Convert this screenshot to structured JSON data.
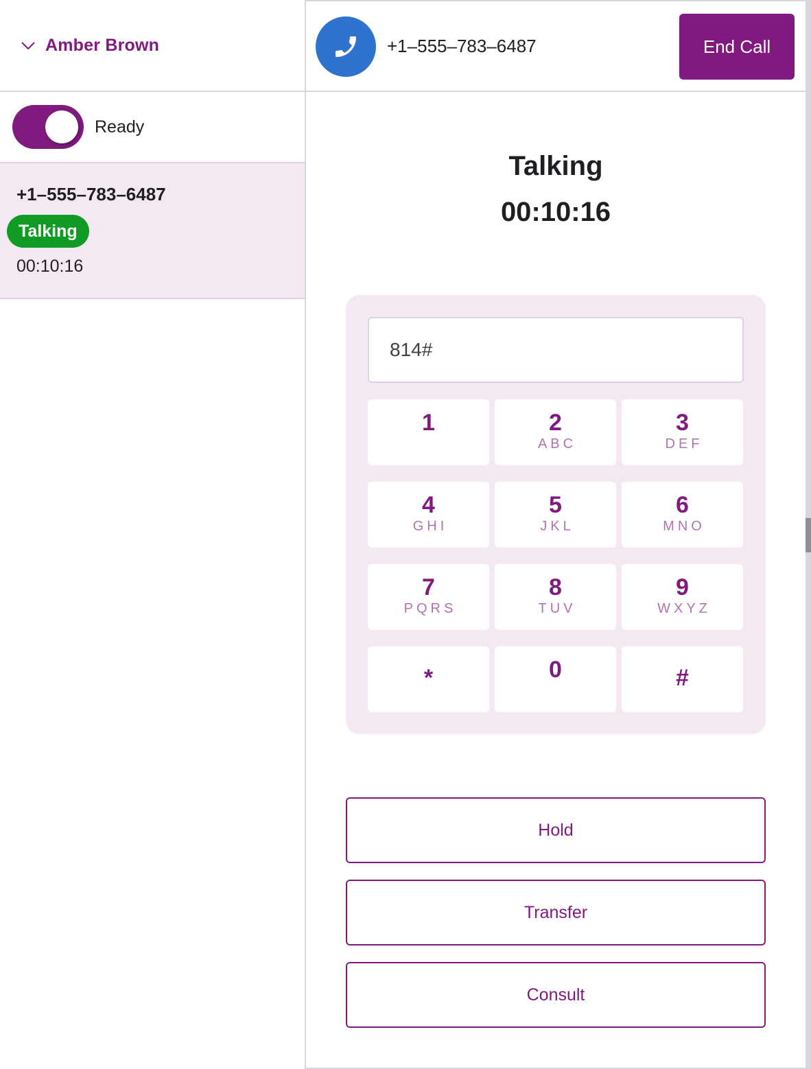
{
  "agent": {
    "name": "Amber Brown",
    "menu_icon": "chevron-down-icon"
  },
  "availability": {
    "label": "Ready",
    "enabled": true
  },
  "call_list": [
    {
      "number": "+1–555–783–6487",
      "status": "Talking",
      "duration": "00:10:16"
    }
  ],
  "active_call": {
    "icon": "phone-icon",
    "number": "+1–555–783–6487",
    "end_call_label": "End Call",
    "state": "Talking",
    "timer": "00:10:16"
  },
  "dialpad": {
    "input_value": "814#",
    "keys": [
      {
        "digit": "1",
        "letters": ""
      },
      {
        "digit": "2",
        "letters": "ABC"
      },
      {
        "digit": "3",
        "letters": "DEF"
      },
      {
        "digit": "4",
        "letters": "GHI"
      },
      {
        "digit": "5",
        "letters": "JKL"
      },
      {
        "digit": "6",
        "letters": "MNO"
      },
      {
        "digit": "7",
        "letters": "PQRS"
      },
      {
        "digit": "8",
        "letters": "TUV"
      },
      {
        "digit": "9",
        "letters": "WXYZ"
      },
      {
        "digit": "*",
        "letters": ""
      },
      {
        "digit": "0",
        "letters": ""
      },
      {
        "digit": "#",
        "letters": ""
      }
    ]
  },
  "actions": {
    "hold": "Hold",
    "transfer": "Transfer",
    "consult": "Consult"
  },
  "colors": {
    "brand": "#801a7f",
    "brand_light": "#f4e9f3",
    "talking_badge": "#0f9b24",
    "phone_avatar": "#2f73d1",
    "border": "#d6d6dc"
  }
}
